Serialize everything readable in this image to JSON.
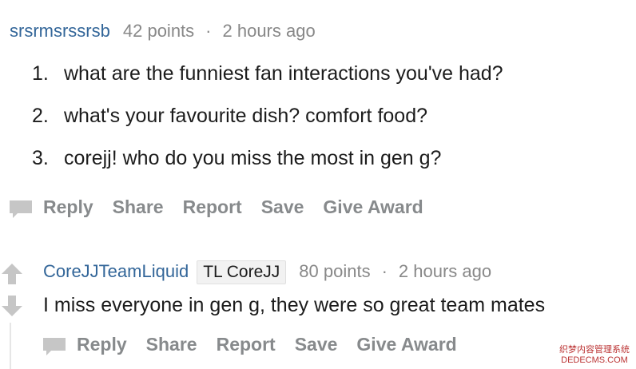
{
  "comment1": {
    "username": "srsrmsrssrsb",
    "points": "42 points",
    "separator": "·",
    "time": "2 hours ago",
    "items": [
      {
        "num": "1.",
        "text": "what are the funniest fan interactions you've had?"
      },
      {
        "num": "2.",
        "text": "what's your favourite dish? comfort food?"
      },
      {
        "num": "3.",
        "text": "corejj! who do you miss the most in gen g?"
      }
    ],
    "actions": {
      "reply": "Reply",
      "share": "Share",
      "report": "Report",
      "save": "Save",
      "award": "Give Award"
    }
  },
  "comment2": {
    "username": "CoreJJTeamLiquid",
    "flair": "TL CoreJJ",
    "points": "80 points",
    "separator": "·",
    "time": "2 hours ago",
    "body": "I miss everyone in gen g, they were so great team mates",
    "actions": {
      "reply": "Reply",
      "share": "Share",
      "report": "Report",
      "save": "Save",
      "award": "Give Award"
    }
  },
  "icons": {
    "upvote": "upvote-arrow-icon",
    "downvote": "downvote-arrow-icon",
    "comment": "comment-bubble-icon"
  },
  "colors": {
    "username": "#336699",
    "muted": "#888888",
    "action": "#878a8c",
    "icon": "#c6c6c6"
  },
  "watermark": {
    "line1": "织梦内容管理系统",
    "line2": "DEDECMS.COM"
  }
}
